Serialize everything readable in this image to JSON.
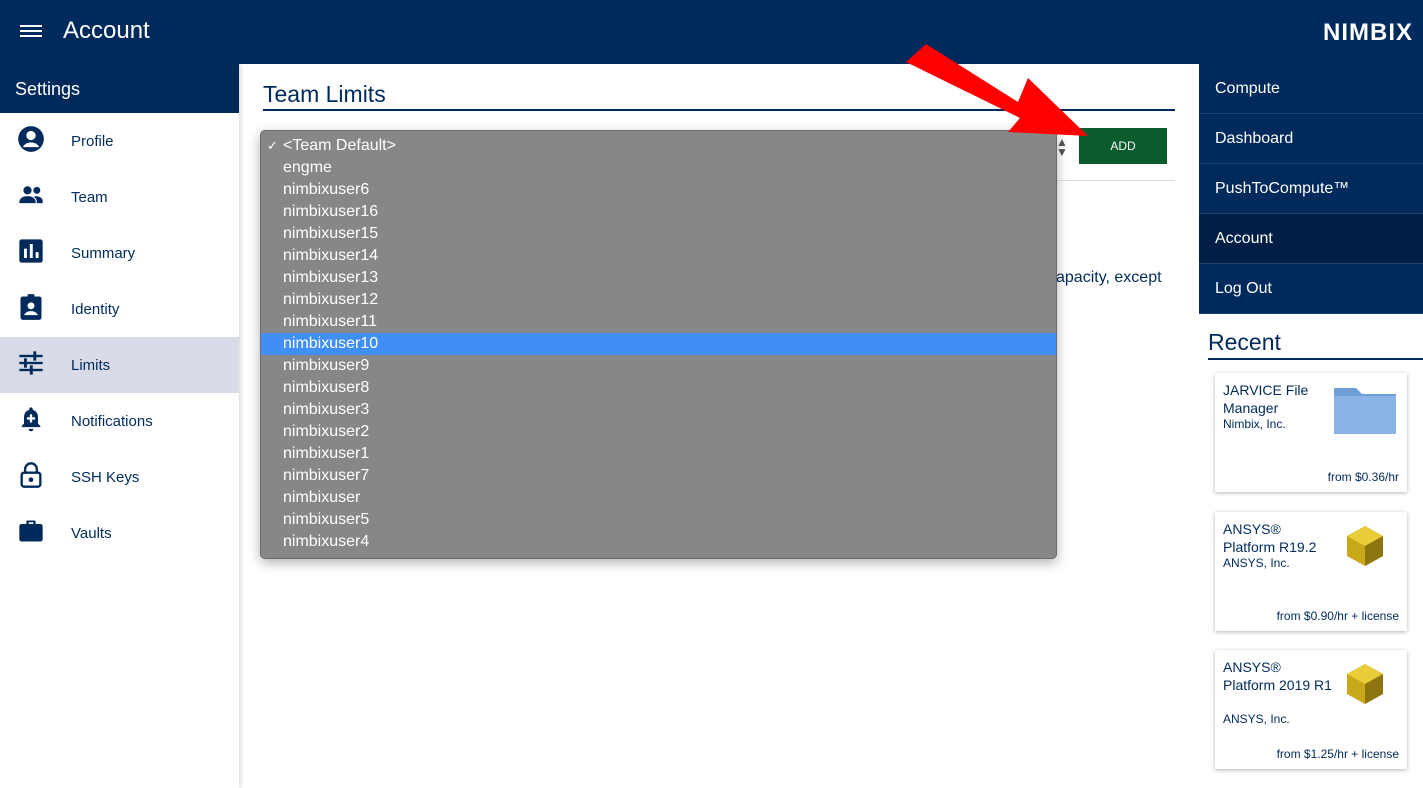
{
  "header": {
    "title": "Account",
    "brand": "NIMBIX"
  },
  "sidebar": {
    "header": "Settings",
    "items": [
      {
        "label": "Profile",
        "icon": "account-circle-icon"
      },
      {
        "label": "Team",
        "icon": "people-icon"
      },
      {
        "label": "Summary",
        "icon": "bar-chart-icon"
      },
      {
        "label": "Identity",
        "icon": "badge-icon"
      },
      {
        "label": "Limits",
        "icon": "sliders-icon",
        "active": true
      },
      {
        "label": "Notifications",
        "icon": "bell-plus-icon"
      },
      {
        "label": "SSH Keys",
        "icon": "lock-icon"
      },
      {
        "label": "Vaults",
        "icon": "briefcase-icon"
      }
    ]
  },
  "main": {
    "title": "Team Limits",
    "add_label": "ADD",
    "description_fragment": "apacity, except"
  },
  "dropdown": {
    "selected": "<Team Default>",
    "highlighted": "nimbixuser10",
    "options": [
      "<Team Default>",
      "engme",
      "nimbixuser6",
      "nimbixuser16",
      "nimbixuser15",
      "nimbixuser14",
      "nimbixuser13",
      "nimbixuser12",
      "nimbixuser11",
      "nimbixuser10",
      "nimbixuser9",
      "nimbixuser8",
      "nimbixuser3",
      "nimbixuser2",
      "nimbixuser1",
      "nimbixuser7",
      "nimbixuser",
      "nimbixuser5",
      "nimbixuser4"
    ]
  },
  "rightnav": {
    "items": [
      {
        "label": "Compute"
      },
      {
        "label": "Dashboard"
      },
      {
        "label": "PushToCompute™"
      },
      {
        "label": "Account",
        "active": true
      },
      {
        "label": "Log Out"
      }
    ]
  },
  "recent": {
    "title": "Recent",
    "cards": [
      {
        "name": "JARVICE File Manager",
        "vendor": "Nimbix, Inc.",
        "price": "from $0.36/hr",
        "icon": "folder-icon"
      },
      {
        "name": "ANSYS® Platform R19.2",
        "vendor": "ANSYS, Inc.",
        "price": "from $0.90/hr + license",
        "icon": "ansys-cube-icon"
      },
      {
        "name": "ANSYS® Platform 2019 R1",
        "vendor": "ANSYS, Inc.",
        "price": "from $1.25/hr + license",
        "icon": "ansys-cube-icon"
      }
    ]
  },
  "colors": {
    "primary": "#002a5c",
    "add_button": "#0a5c2c",
    "highlight": "#3f8ff7",
    "dropdown_bg": "#878787",
    "arrow": "#ff0000"
  }
}
